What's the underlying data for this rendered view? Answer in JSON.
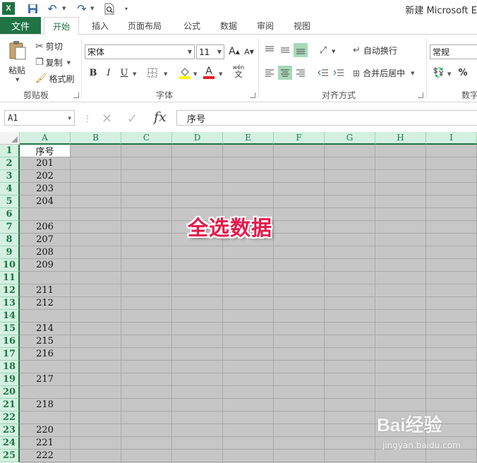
{
  "titlebar": {
    "app_logo": "X",
    "title": "新建 Microsoft E"
  },
  "tabs": {
    "file": "文件",
    "items": [
      "开始",
      "插入",
      "页面布局",
      "公式",
      "数据",
      "审阅",
      "视图"
    ]
  },
  "ribbon": {
    "clipboard": {
      "paste": "粘贴",
      "cut": "剪切",
      "copy": "复制",
      "format_painter": "格式刷",
      "label": "剪贴板"
    },
    "font": {
      "name": "宋体",
      "size": "11",
      "bold": "B",
      "italic": "I",
      "underline": "U",
      "phonetic": "wén",
      "font_color_letter": "A",
      "highlight_color": "#ffff00",
      "font_color": "#e02020",
      "label": "字体"
    },
    "alignment": {
      "wrap_text": "自动换行",
      "merge_center": "合并后居中",
      "label": "对齐方式"
    },
    "number": {
      "format": "常规",
      "percent": "%",
      "label": "数字"
    }
  },
  "formula_bar": {
    "name_box": "A1",
    "fx": "fx",
    "content": "序号"
  },
  "sheet": {
    "columns": [
      "A",
      "B",
      "C",
      "D",
      "E",
      "F",
      "G",
      "H",
      "I"
    ],
    "rows": [
      "1",
      "2",
      "3",
      "4",
      "5",
      "6",
      "7",
      "8",
      "9",
      "10",
      "11",
      "12",
      "13",
      "14",
      "15",
      "16",
      "17",
      "18",
      "19",
      "20",
      "21",
      "22",
      "23",
      "24",
      "25"
    ],
    "column_a": [
      "序号",
      "201",
      "202",
      "203",
      "204",
      "",
      "206",
      "207",
      "208",
      "209",
      "",
      "211",
      "212",
      "",
      "214",
      "215",
      "216",
      "",
      "217",
      "",
      "218",
      "",
      "220",
      "221",
      "222"
    ],
    "selection_color": "#c6c6c6",
    "accent_color": "#217346"
  },
  "overlay_annotation": "全选数据",
  "watermark": {
    "logo": "Bai经验",
    "url": "jingyan.baidu.com"
  }
}
